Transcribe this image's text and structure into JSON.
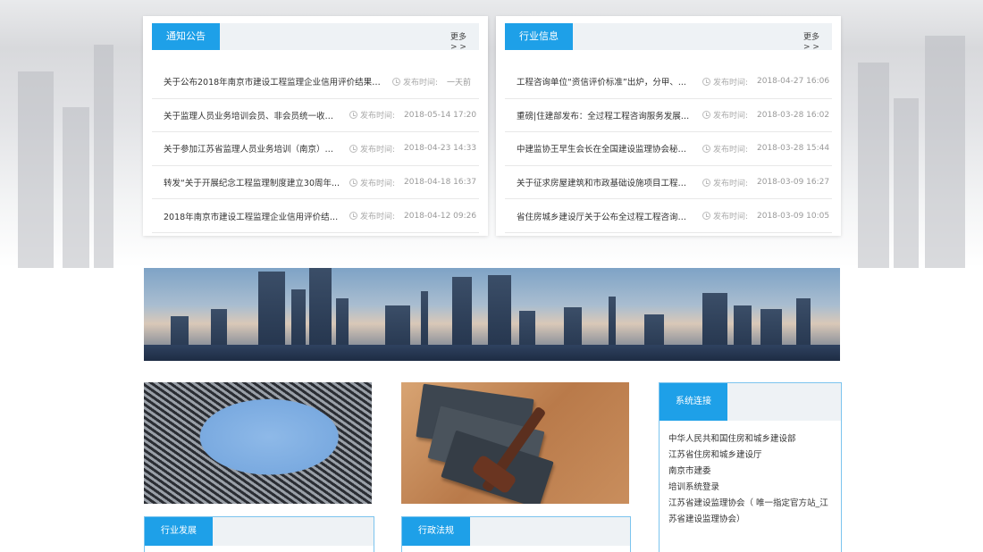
{
  "notice": {
    "tab": "通知公告",
    "more": "更多> >",
    "items": [
      {
        "title": "关于公布2018年南京市建设工程监理企业信用评价结果的...",
        "label": "发布时间:",
        "date": "一天前"
      },
      {
        "title": "关于监理人员业务培训会员、非会员统一收费...",
        "label": "发布时间:",
        "date": "2018-05-14 17:20"
      },
      {
        "title": "关于参加江苏省监理人员业务培训（南京）打...",
        "label": "发布时间:",
        "date": "2018-04-23 14:33"
      },
      {
        "title": "转发“关于开展纪念工程监理制度建立30周年...",
        "label": "发布时间:",
        "date": "2018-04-18 16:37"
      },
      {
        "title": "2018年南京市建设工程监理企业信用评价结果...",
        "label": "发布时间:",
        "date": "2018-04-12 09:26"
      }
    ]
  },
  "industry": {
    "tab": "行业信息",
    "more": "更多> >",
    "items": [
      {
        "title": "工程咨询单位“资信评价标准”出炉，分甲、...",
        "label": "发布时间:",
        "date": "2018-04-27 16:06"
      },
      {
        "title": "重磅|住建部发布：全过程工程咨询服务发展的...",
        "label": "发布时间:",
        "date": "2018-03-28 16:02"
      },
      {
        "title": "中建监协王早生会长在全国建设监理协会秘书...",
        "label": "发布时间:",
        "date": "2018-03-28 15:44"
      },
      {
        "title": "关于征求房屋建筑和市政基础设施项目工程总...",
        "label": "发布时间:",
        "date": "2018-03-09 16:27"
      },
      {
        "title": "省住房城乡建设厅关于公布全过程工程咨询试...",
        "label": "发布时间:",
        "date": "2018-03-09 10:05"
      }
    ]
  },
  "bottom": {
    "development_tab": "行业发展",
    "regulation_tab": "行政法规",
    "system_tab": "系统连接",
    "system_links": [
      "中华人民共和国住房和城乡建设部",
      "江苏省住房和城乡建设厅",
      "南京市建委",
      "培训系统登录",
      "江苏省建设监理协会（ 唯一指定官方站_江苏省建设监理协会）"
    ]
  },
  "colors": {
    "accent": "#1ea0e8",
    "border": "#7cc4ee"
  }
}
